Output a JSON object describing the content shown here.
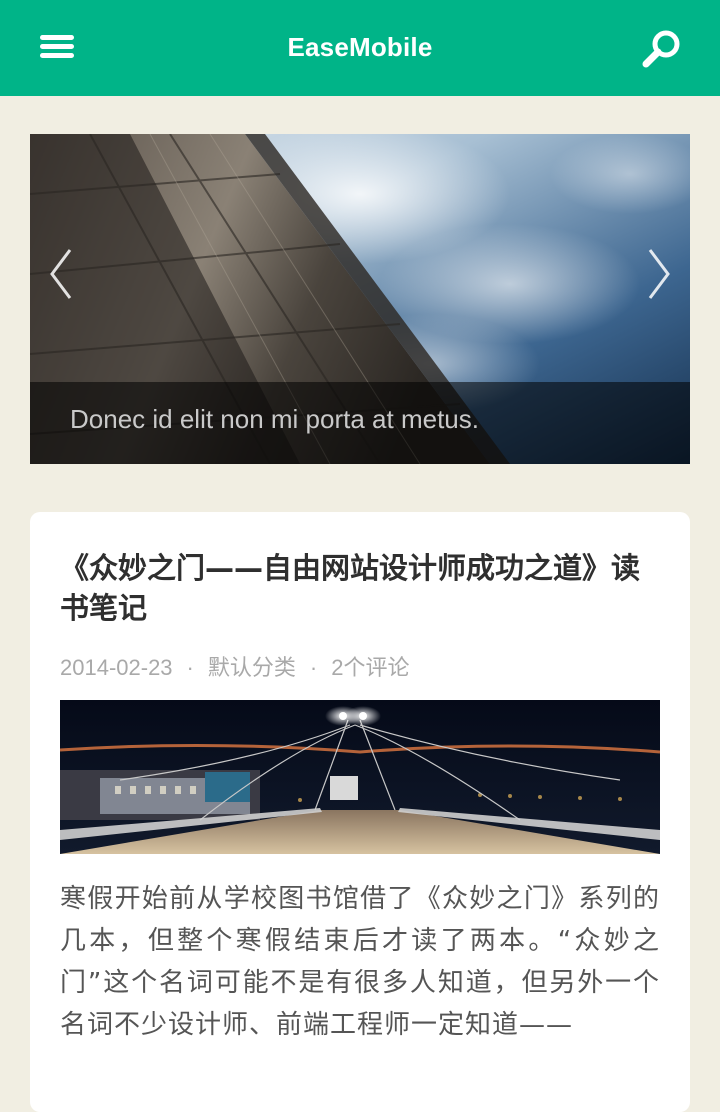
{
  "header": {
    "brand": "EaseMobile",
    "menu_icon": "hamburger-menu-icon",
    "search_icon": "search-icon",
    "background": "#00b488"
  },
  "slider": {
    "caption": "Donec id elit non mi porta at metus.",
    "prev_icon": "chevron-left-icon",
    "next_icon": "chevron-right-icon"
  },
  "post": {
    "title": "《众妙之门——自由网站设计师成功之道》读书笔记",
    "date": "2014-02-23",
    "separator": "·",
    "category": "默认分类",
    "comments": "2个评论",
    "excerpt": "寒假开始前从学校图书馆借了《众妙之门》系列的几本，但整个寒假结束后才读了两本。“众妙之门”这个名词可能不是有很多人知道，但另外一个名词不少设计师、前端工程师一定知道——"
  },
  "colors": {
    "page_background": "#f1eee2",
    "accent": "#00b488"
  }
}
